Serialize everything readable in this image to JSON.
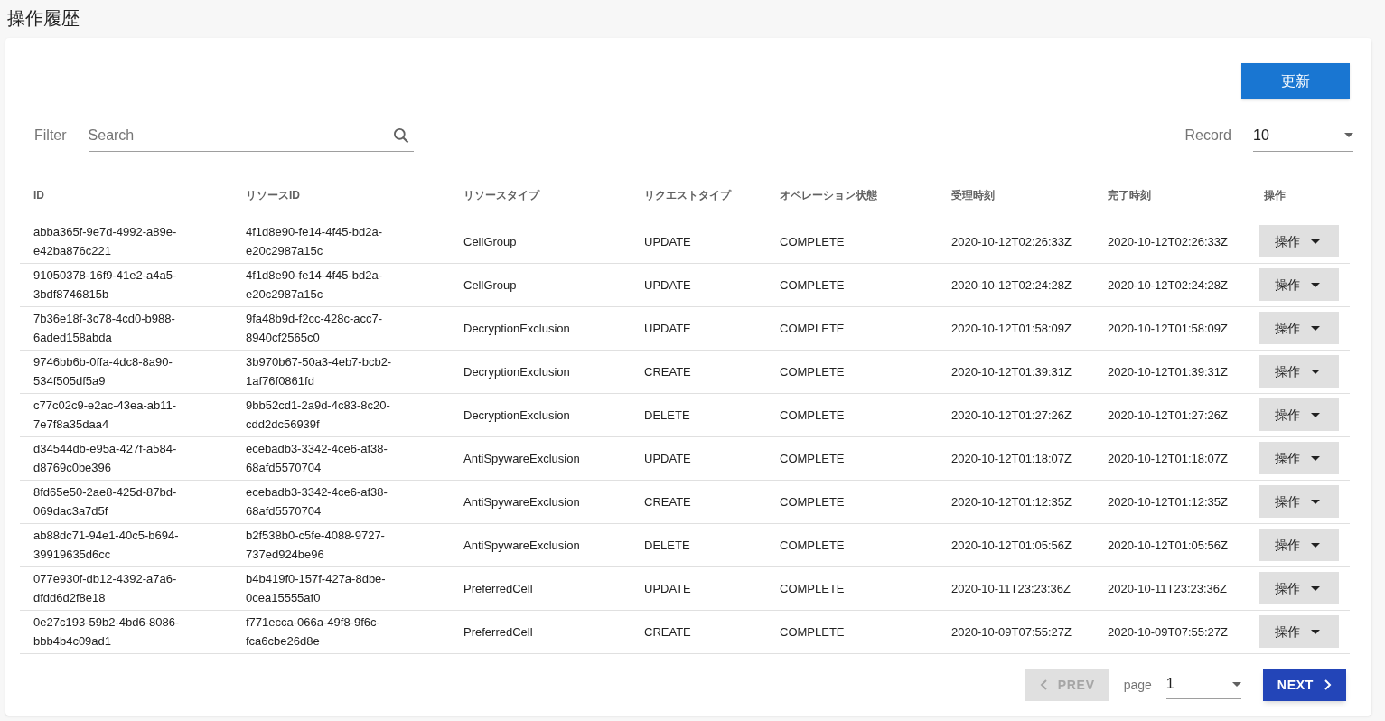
{
  "page_title": "操作履歴",
  "refresh_button": "更新",
  "filter": {
    "label": "Filter",
    "placeholder": "Search"
  },
  "record": {
    "label": "Record",
    "value": "10"
  },
  "table": {
    "columns": [
      "ID",
      "リソースID",
      "リソースタイプ",
      "リクエストタイプ",
      "オペレーション状態",
      "受理時刻",
      "完了時刻",
      "操作"
    ],
    "rows": [
      {
        "id": "abba365f-9e7d-4992-a89e-e42ba876c221",
        "resource_id": "4f1d8e90-fe14-4f45-bd2a-e20c2987a15c",
        "resource_type": "CellGroup",
        "request_type": "UPDATE",
        "status": "COMPLETE",
        "received": "2020-10-12T02:26:33Z",
        "completed": "2020-10-12T02:26:33Z",
        "action": "操作"
      },
      {
        "id": "91050378-16f9-41e2-a4a5-3bdf8746815b",
        "resource_id": "4f1d8e90-fe14-4f45-bd2a-e20c2987a15c",
        "resource_type": "CellGroup",
        "request_type": "UPDATE",
        "status": "COMPLETE",
        "received": "2020-10-12T02:24:28Z",
        "completed": "2020-10-12T02:24:28Z",
        "action": "操作"
      },
      {
        "id": "7b36e18f-3c78-4cd0-b988-6aded158abda",
        "resource_id": "9fa48b9d-f2cc-428c-acc7-8940cf2565c0",
        "resource_type": "DecryptionExclusion",
        "request_type": "UPDATE",
        "status": "COMPLETE",
        "received": "2020-10-12T01:58:09Z",
        "completed": "2020-10-12T01:58:09Z",
        "action": "操作"
      },
      {
        "id": "9746bb6b-0ffa-4dc8-8a90-534f505df5a9",
        "resource_id": "3b970b67-50a3-4eb7-bcb2-1af76f0861fd",
        "resource_type": "DecryptionExclusion",
        "request_type": "CREATE",
        "status": "COMPLETE",
        "received": "2020-10-12T01:39:31Z",
        "completed": "2020-10-12T01:39:31Z",
        "action": "操作"
      },
      {
        "id": "c77c02c9-e2ac-43ea-ab11-7e7f8a35daa4",
        "resource_id": "9bb52cd1-2a9d-4c83-8c20-cdd2dc56939f",
        "resource_type": "DecryptionExclusion",
        "request_type": "DELETE",
        "status": "COMPLETE",
        "received": "2020-10-12T01:27:26Z",
        "completed": "2020-10-12T01:27:26Z",
        "action": "操作"
      },
      {
        "id": "d34544db-e95a-427f-a584-d8769c0be396",
        "resource_id": "ecebadb3-3342-4ce6-af38-68afd5570704",
        "resource_type": "AntiSpywareExclusion",
        "request_type": "UPDATE",
        "status": "COMPLETE",
        "received": "2020-10-12T01:18:07Z",
        "completed": "2020-10-12T01:18:07Z",
        "action": "操作"
      },
      {
        "id": "8fd65e50-2ae8-425d-87bd-069dac3a7d5f",
        "resource_id": "ecebadb3-3342-4ce6-af38-68afd5570704",
        "resource_type": "AntiSpywareExclusion",
        "request_type": "CREATE",
        "status": "COMPLETE",
        "received": "2020-10-12T01:12:35Z",
        "completed": "2020-10-12T01:12:35Z",
        "action": "操作"
      },
      {
        "id": "ab88dc71-94e1-40c5-b694-39919635d6cc",
        "resource_id": "b2f538b0-c5fe-4088-9727-737ed924be96",
        "resource_type": "AntiSpywareExclusion",
        "request_type": "DELETE",
        "status": "COMPLETE",
        "received": "2020-10-12T01:05:56Z",
        "completed": "2020-10-12T01:05:56Z",
        "action": "操作"
      },
      {
        "id": "077e930f-db12-4392-a7a6-dfdd6d2f8e18",
        "resource_id": "b4b419f0-157f-427a-8dbe-0cea15555af0",
        "resource_type": "PreferredCell",
        "request_type": "UPDATE",
        "status": "COMPLETE",
        "received": "2020-10-11T23:23:36Z",
        "completed": "2020-10-11T23:23:36Z",
        "action": "操作"
      },
      {
        "id": "0e27c193-59b2-4bd6-8086-bbb4b4c09ad1",
        "resource_id": "f771ecca-066a-49f8-9f6c-fca6cbe26d8e",
        "resource_type": "PreferredCell",
        "request_type": "CREATE",
        "status": "COMPLETE",
        "received": "2020-10-09T07:55:27Z",
        "completed": "2020-10-09T07:55:27Z",
        "action": "操作"
      }
    ]
  },
  "pagination": {
    "prev": {
      "label": "PREV",
      "disabled": true
    },
    "page_label": "page",
    "page_value": "1",
    "next": {
      "label": "NEXT",
      "disabled": false
    }
  }
}
